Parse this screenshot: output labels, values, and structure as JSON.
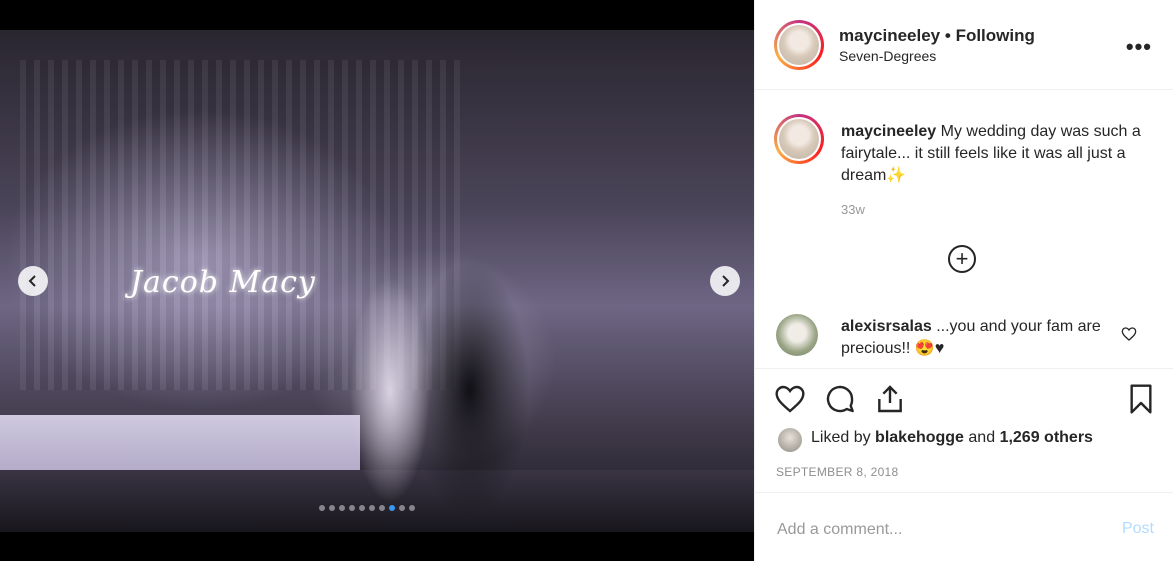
{
  "post": {
    "carousel": {
      "dot_count": 10,
      "active_index": 7,
      "neon_sign": "Jacob Macy"
    },
    "header": {
      "username": "maycineeley",
      "separator": "•",
      "follow_status": "Following",
      "location": "Seven-Degrees",
      "more_label": "•••"
    },
    "caption": {
      "username": "maycineeley",
      "text": "My wedding day was such a fairytale... it still feels like it was all just a dream✨",
      "age": "33w"
    },
    "load_more_label": "+",
    "comments": [
      {
        "username": "alexisrsalas",
        "text": "...you and your fam are precious!! 😍♥"
      }
    ],
    "likes": {
      "prefix": "Liked by",
      "first_user": "blakehogge",
      "conjunction": "and",
      "others": "1,269 others"
    },
    "date": "SEPTEMBER 8, 2018",
    "add_comment": {
      "placeholder": "Add a comment...",
      "post_label": "Post"
    }
  },
  "icons": {
    "prev": "chevron-left-icon",
    "next": "chevron-right-icon",
    "like": "heart-icon",
    "comment": "comment-bubble-icon",
    "share": "share-icon",
    "save": "bookmark-icon"
  },
  "colors": {
    "accent": "#3897f0",
    "post_disabled": "#b3dbff",
    "text": "#262626",
    "muted": "#8e8e8e"
  }
}
